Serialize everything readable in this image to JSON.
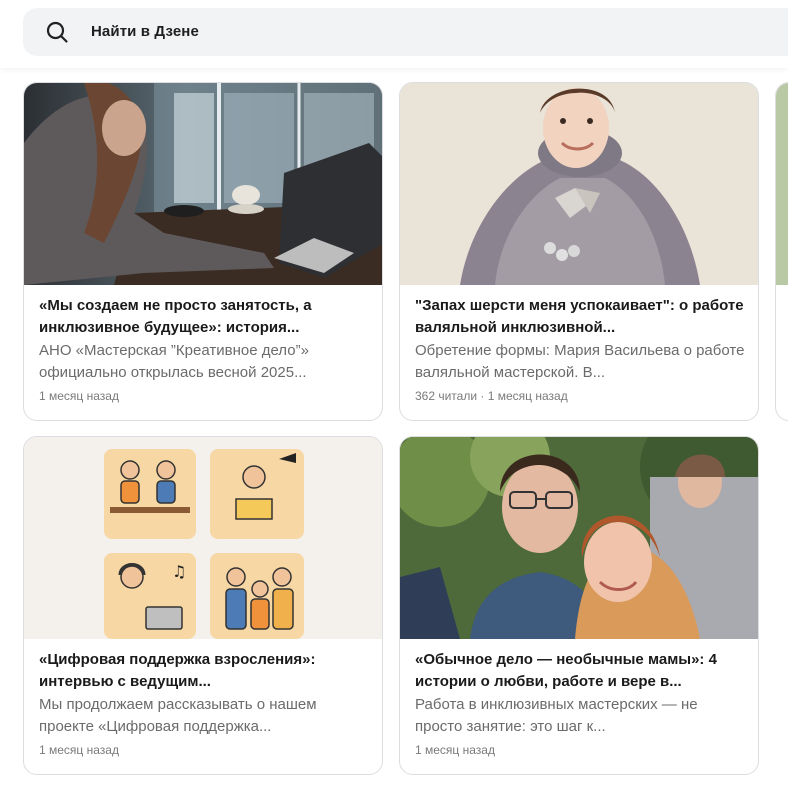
{
  "search": {
    "placeholder": "Найти в Дзене",
    "icon": "search-icon"
  },
  "cards": [
    {
      "title": "«Мы создаем не просто занятость, а инклюзивное будущее»: история...",
      "snippet": "АНО «Мастерская ”Креативное дело”» официально открылась весной 2025...",
      "meta": "1 месяц назад",
      "image": "woman-laptop-photo"
    },
    {
      "title": "\"Запах шерсти меня успокаивает\": о работе валяльной инклюзивной...",
      "snippet": "Обретение формы: Мария Васильева о работе валяльной мастерской. В...",
      "meta": "362 читали · 1 месяц назад",
      "image": "girl-felt-cape-photo"
    },
    {
      "title": "«Цифровая поддержка взросления»: интервью с ведущим...",
      "snippet": "Мы продолжаем рассказывать о нашем проекте «Цифровая поддержка...",
      "meta": "1 месяц назад",
      "image": "illustration-grid"
    },
    {
      "title": "«Обычное дело — необычные мамы»: 4 истории о любви, работе и вере в...",
      "snippet": "Работа в инклюзивных мастерских — не просто занятие: это шаг к...",
      "meta": "1 месяц назад",
      "image": "couple-photo"
    }
  ]
}
